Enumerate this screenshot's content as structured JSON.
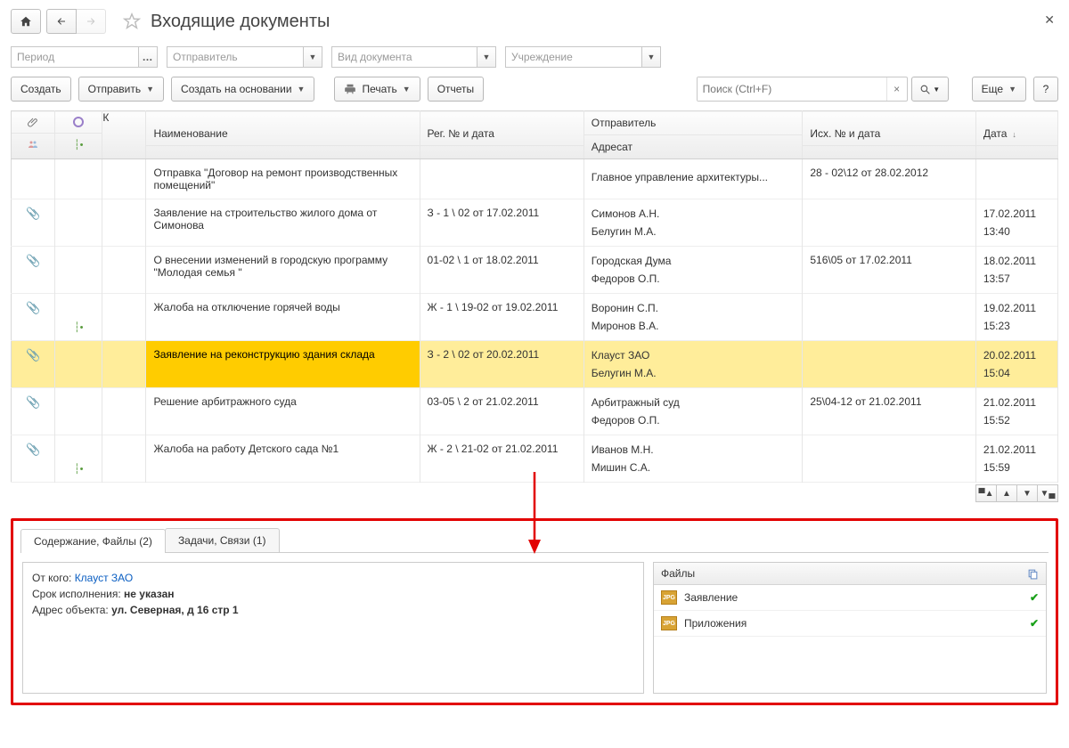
{
  "title": "Входящие документы",
  "filters": {
    "period": "Период",
    "sender": "Отправитель",
    "doc_type": "Вид документа",
    "org": "Учреждение"
  },
  "toolbar": {
    "create": "Создать",
    "send": "Отправить",
    "create_based": "Создать на основании",
    "print": "Печать",
    "reports": "Отчеты",
    "more": "Еще",
    "help": "?"
  },
  "search": {
    "placeholder": "Поиск (Ctrl+F)"
  },
  "columns": {
    "k": "К",
    "name": "Наименование",
    "reg": "Рег. № и дата",
    "sender": "Отправитель",
    "addressee": "Адресат",
    "outgoing": "Исх. № и дата",
    "date": "Дата"
  },
  "rows": [
    {
      "clip": false,
      "tree": false,
      "name": "Отправка \"Договор на ремонт производственных помещений\"",
      "reg": "",
      "sender_top": "Главное управление архитектуры...",
      "sender_bot": "",
      "out": "28 - 02\\12 от 28.02.2012",
      "date_top": "",
      "date_bot": ""
    },
    {
      "clip": true,
      "tree": false,
      "name": "Заявление на строительство жилого дома от Симонова",
      "reg": "З - 1 \\ 02 от 17.02.2011",
      "sender_top": "Симонов А.Н.",
      "sender_bot": "Белугин М.А.",
      "out": "",
      "date_top": "17.02.2011",
      "date_bot": "13:40"
    },
    {
      "clip": true,
      "tree": false,
      "name": "О внесении изменений в городскую программу \"Молодая семья \"",
      "reg": "01-02 \\ 1 от 18.02.2011",
      "sender_top": "Городская Дума",
      "sender_bot": "Федоров О.П.",
      "out": "516\\05 от 17.02.2011",
      "date_top": "18.02.2011",
      "date_bot": "13:57"
    },
    {
      "clip": true,
      "tree": true,
      "name": "Жалоба на отключение горячей воды",
      "reg": "Ж - 1 \\ 19-02 от 19.02.2011",
      "sender_top": "Воронин С.П.",
      "sender_bot": "Миронов В.А.",
      "out": "",
      "date_top": "19.02.2011",
      "date_bot": "15:23"
    },
    {
      "clip": true,
      "tree": false,
      "selected": true,
      "name": "Заявление на реконструкцию здания склада",
      "reg": "З - 2 \\ 02 от 20.02.2011",
      "sender_top": "Клауст ЗАО",
      "sender_bot": "Белугин М.А.",
      "out": "",
      "date_top": "20.02.2011",
      "date_bot": "15:04"
    },
    {
      "clip": true,
      "tree": false,
      "name": "Решение арбитражного суда",
      "reg": "03-05 \\ 2 от 21.02.2011",
      "sender_top": "Арбитражный суд",
      "sender_bot": "Федоров О.П.",
      "out": "25\\04-12 от 21.02.2011",
      "date_top": "21.02.2011",
      "date_bot": "15:52"
    },
    {
      "clip": true,
      "tree": true,
      "name": "Жалоба на работу Детского сада №1",
      "reg": "Ж - 2 \\ 21-02 от 21.02.2011",
      "sender_top": "Иванов М.Н.",
      "sender_bot": "Мишин С.А.",
      "out": "",
      "date_top": "21.02.2011",
      "date_bot": "15:59"
    }
  ],
  "tabs": {
    "content": "Содержание, Файлы (2)",
    "tasks": "Задачи, Связи (1)"
  },
  "detail": {
    "from_label": "От кого: ",
    "from_value": "Клауст ЗАО",
    "deadline_label": "Срок исполнения: ",
    "deadline_value": "не указан",
    "address_label": "Адрес объекта: ",
    "address_value": "ул. Северная, д 16 стр 1",
    "files_header": "Файлы",
    "files": [
      {
        "name": "Заявление"
      },
      {
        "name": "Приложения"
      }
    ]
  }
}
